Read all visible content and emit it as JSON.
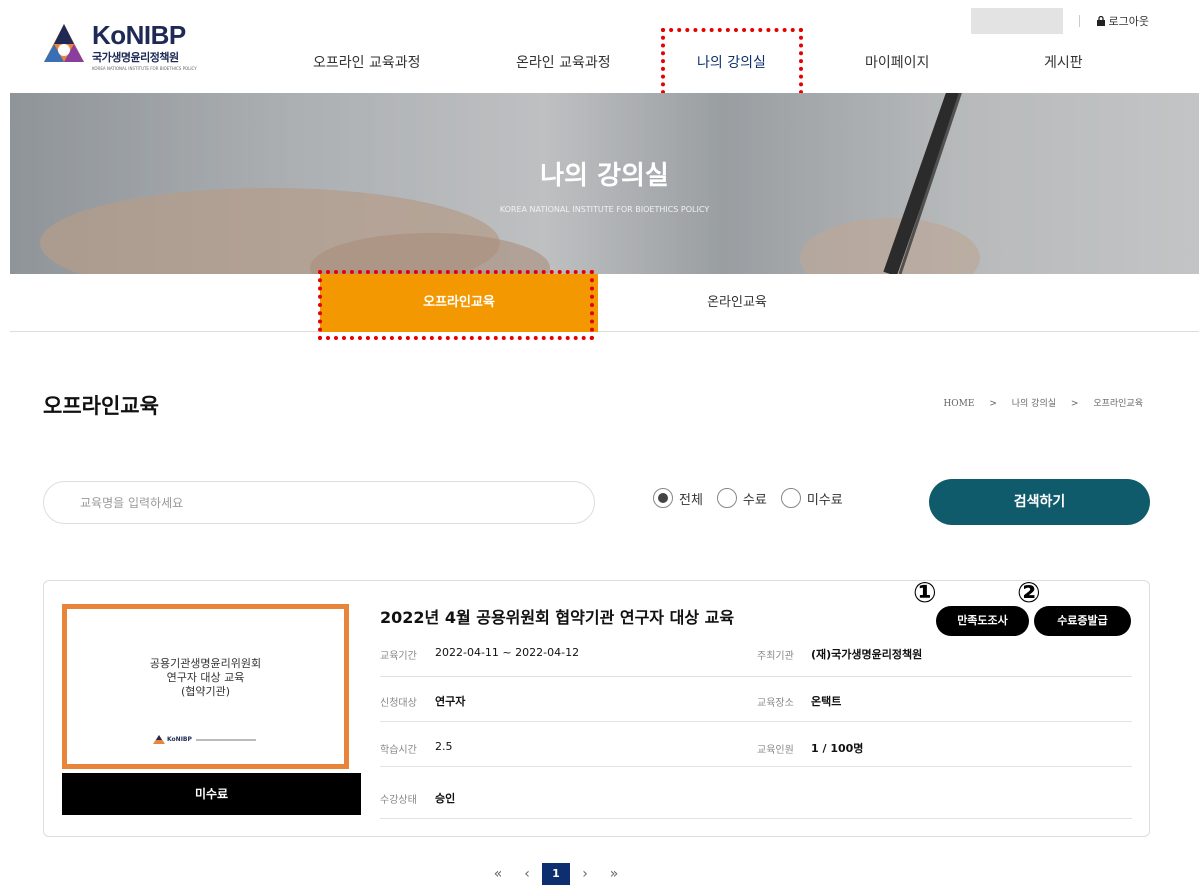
{
  "header": {
    "logo_title": "KoNIBP",
    "logo_subtitle": "국가생명윤리정책원",
    "logo_english": "KOREA NATIONAL INSTITUTE FOR BIOETHICS POLICY",
    "logout_label": "로그아웃",
    "icons": {
      "logo": "konibp-logo-icon",
      "lock": "lock-icon"
    },
    "nav": [
      {
        "label": "오프라인 교육과정"
      },
      {
        "label": "온라인 교육과정"
      },
      {
        "label": "나의 강의실",
        "active": true
      },
      {
        "label": "마이페이지"
      },
      {
        "label": "게시판"
      }
    ]
  },
  "banner": {
    "title": "나의 강의실",
    "subtitle": "KOREA NATIONAL INSTITUTE FOR BIOETHICS POLICY"
  },
  "subtabs": [
    {
      "label": "오프라인교육",
      "active": true
    },
    {
      "label": "온라인교육"
    }
  ],
  "page": {
    "title": "오프라인교육",
    "breadcrumb": [
      "HOME",
      ">",
      "나의 강의실",
      ">",
      "오프라인교육"
    ]
  },
  "search": {
    "placeholder": "교육명을 입력하세요",
    "filters": [
      {
        "label": "전체",
        "checked": true
      },
      {
        "label": "수료",
        "checked": false
      },
      {
        "label": "미수료",
        "checked": false
      }
    ],
    "button_label": "검색하기"
  },
  "course": {
    "thumbnail": {
      "lines": [
        "공용기관생명윤리위원회",
        "연구자 대상 교육",
        "(협약기관)"
      ],
      "logo_text": "KoNIBP"
    },
    "status": "미수료",
    "title": "2022년 4월 공용위원회 협약기관 연구자 대상 교육",
    "survey_button": "만족도조사",
    "certificate_button": "수료증발급",
    "marker_1": "①",
    "marker_2": "②",
    "fields": {
      "period_label": "교육기간",
      "period_value": "2022-04-11 ~ 2022-04-12",
      "host_label": "주최기관",
      "host_value": "(재)국가생명윤리정책원",
      "target_label": "신청대상",
      "target_value": "연구자",
      "place_label": "교육장소",
      "place_value": "온택트",
      "hours_label": "학습시간",
      "hours_value": "2.5",
      "count_label": "교육인원",
      "count_value": "1 / 100명",
      "state_label": "수강상태",
      "state_value": "승인"
    }
  },
  "pagination": {
    "first": "«",
    "prev": "‹",
    "current": "1",
    "next": "›",
    "last": "»"
  },
  "colors": {
    "accent_orange": "#f39800",
    "primary_navy": "#0d2f70",
    "search_button": "#0f5a6b",
    "highlight_red": "#e60000"
  }
}
